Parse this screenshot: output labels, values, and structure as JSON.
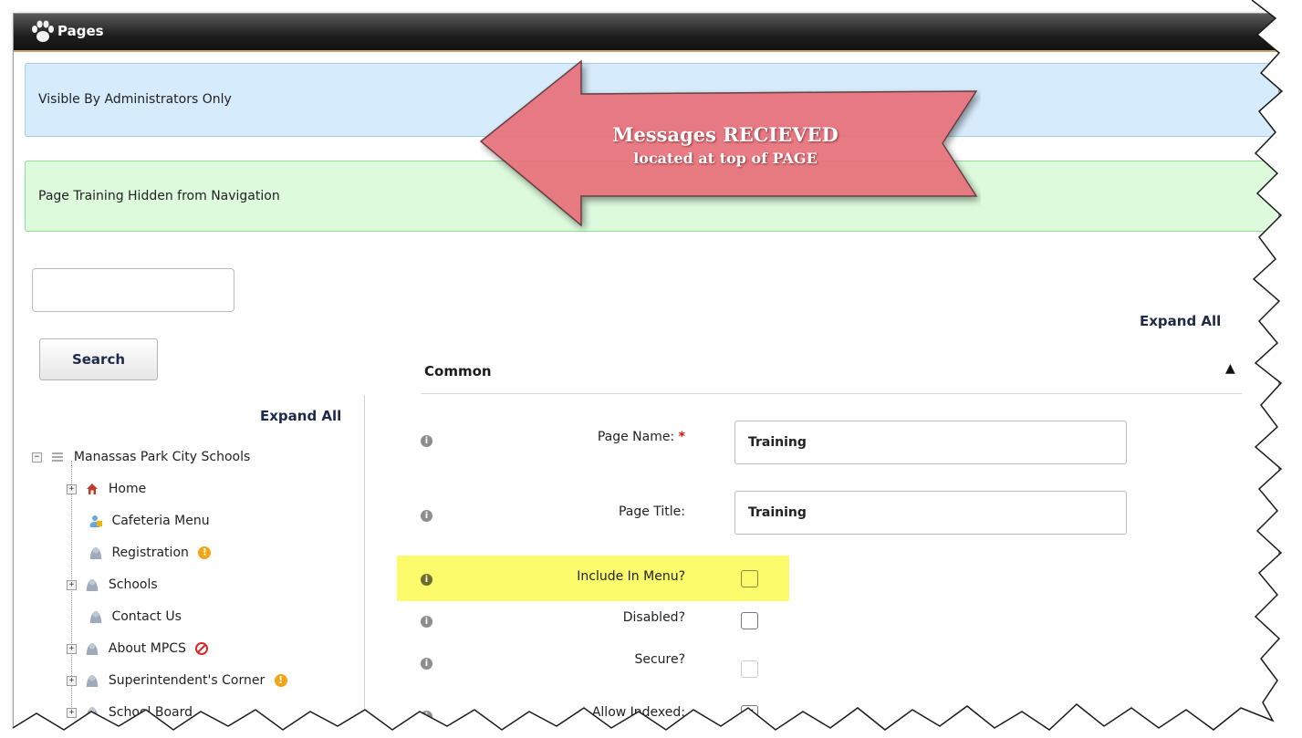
{
  "window": {
    "title": "Pages",
    "logo_icon": "paw-icon"
  },
  "messages": {
    "visibility": "Visible By Administrators Only",
    "navigation": "Page Training Hidden from Navigation"
  },
  "callout": {
    "line1": "Messages RECIEVED",
    "line2": "located at top of PAGE",
    "color": "#e8707a"
  },
  "sidebar": {
    "search_value": "",
    "search_button": "Search",
    "expand_all": "Expand All",
    "tree": [
      {
        "label": "Manassas Park City Schools",
        "icon": "list-icon",
        "toggle": "−"
      },
      {
        "label": "Home",
        "icon": "home-icon",
        "toggle": "+"
      },
      {
        "label": "Cafeteria Menu",
        "icon": "locked-user-icon",
        "toggle": ""
      },
      {
        "label": "Registration",
        "icon": "user-icon",
        "toggle": "",
        "badge": "warning-icon"
      },
      {
        "label": "Schools",
        "icon": "user-icon",
        "toggle": "+"
      },
      {
        "label": "Contact Us",
        "icon": "user-icon",
        "toggle": ""
      },
      {
        "label": "About MPCS",
        "icon": "user-icon",
        "toggle": "+",
        "badge": "blocked-icon"
      },
      {
        "label": "Superintendent's Corner",
        "icon": "user-icon",
        "toggle": "+",
        "badge": "warning-icon"
      },
      {
        "label": "School Board",
        "icon": "user-icon",
        "toggle": "+"
      }
    ]
  },
  "main": {
    "expand_all": "Expand All",
    "section": "Common",
    "fields": {
      "page_name": {
        "label": "Page Name:",
        "required": "*",
        "value": "Training"
      },
      "page_title": {
        "label": "Page Title:",
        "value": "Training"
      },
      "include_in_menu": {
        "label": "Include In Menu?",
        "checked": false
      },
      "disabled": {
        "label": "Disabled?",
        "checked": false
      },
      "secure": {
        "label": "Secure?",
        "checked": false
      },
      "allow_indexed": {
        "label": "Allow Indexed:",
        "checked": true
      }
    }
  },
  "colors": {
    "info_blue": "#d6ebfb",
    "success_green": "#ddfadd",
    "highlight": "#fbfb6c",
    "link_navy": "#1f2a4b"
  }
}
